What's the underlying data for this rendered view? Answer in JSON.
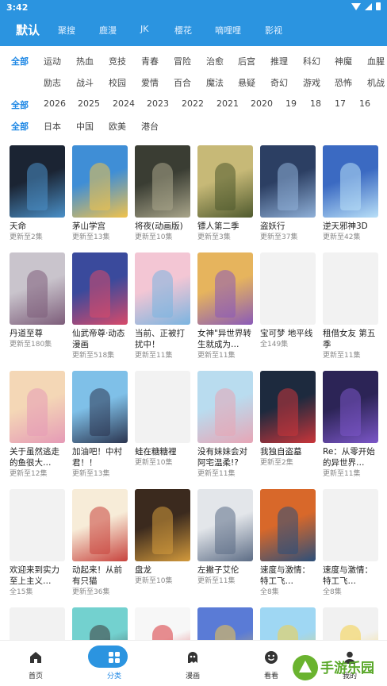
{
  "status_bar": {
    "time": "3:42"
  },
  "top_tabs": [
    "默认",
    "聚搜",
    "鹿漫",
    "JK",
    "樱花",
    "嘀哩哩",
    "影视"
  ],
  "filters": {
    "genre_row1": [
      "全部",
      "运动",
      "热血",
      "竞技",
      "青春",
      "冒险",
      "治愈",
      "后宫",
      "推理",
      "科幻",
      "神魔",
      "血腥"
    ],
    "genre_row2": [
      "励志",
      "战斗",
      "校园",
      "爱情",
      "百合",
      "魔法",
      "悬疑",
      "奇幻",
      "游戏",
      "恐怖",
      "机战"
    ],
    "years": [
      "全部",
      "2026",
      "2025",
      "2024",
      "2023",
      "2022",
      "2021",
      "2020",
      "19",
      "18",
      "17",
      "16"
    ],
    "regions": [
      "全部",
      "日本",
      "中国",
      "欧美",
      "港台"
    ]
  },
  "cards": [
    {
      "title": "天命",
      "sub": "更新至2集",
      "color": "#1b2433",
      "accent": "#4a90c8"
    },
    {
      "title": "茅山学宫",
      "sub": "更新至13集",
      "color": "#3f8ed6",
      "accent": "#f1c24b"
    },
    {
      "title": "将夜(动画版)",
      "sub": "更新至10集",
      "color": "#3a3d33",
      "accent": "#a9a58a"
    },
    {
      "title": "镖人第二季",
      "sub": "更新至3集",
      "color": "#c7b977",
      "accent": "#4f5a2e"
    },
    {
      "title": "盗妖行",
      "sub": "更新至37集",
      "color": "#2c3f63",
      "accent": "#8fb0d8"
    },
    {
      "title": "逆天邪神3D",
      "sub": "更新至42集",
      "color": "#3b6ac2",
      "accent": "#b9e0f8"
    },
    {
      "title": "丹道至尊",
      "sub": "更新至180集",
      "color": "#c9c4cc",
      "accent": "#7d5d7a"
    },
    {
      "title": "仙武帝尊·动态漫画",
      "sub": "更新至518集",
      "color": "#3a4a9c",
      "accent": "#d84a6a"
    },
    {
      "title": "当前、正被打扰中！",
      "sub": "更新至11集",
      "color": "#f3c6d4",
      "accent": "#7ab4e0"
    },
    {
      "title": "女神\"异世界转生就成为…",
      "sub": "更新至11集",
      "color": "#e6b45d",
      "accent": "#8a5ab8"
    },
    {
      "title": "宝可梦 地平线",
      "sub": "全149集",
      "color": "#f2f2f2",
      "accent": "#f2f2f2"
    },
    {
      "title": "租借女友 第五季",
      "sub": "更新至11集",
      "color": "#f2f2f2",
      "accent": "#f2f2f2"
    },
    {
      "title": "关于虽然逃走的鱼很大…",
      "sub": "更新至12集",
      "color": "#f4d7b6",
      "accent": "#e59ab6"
    },
    {
      "title": "加油吧！中村君！！",
      "sub": "更新至13集",
      "color": "#7fc0e8",
      "accent": "#2b3550"
    },
    {
      "title": "蛙在糖糖裡",
      "sub": "更新至10集",
      "color": "#f2f2f2",
      "accent": "#f2f2f2"
    },
    {
      "title": "没有妹妹会对阿宅温柔!?",
      "sub": "更新至11集",
      "color": "#b9dcef",
      "accent": "#e7a5b5"
    },
    {
      "title": "我独自盗墓",
      "sub": "更新至2集",
      "color": "#1d2a3e",
      "accent": "#c9353a"
    },
    {
      "title": "Re：从零开始的异世界…",
      "sub": "更新至11集",
      "color": "#2c2456",
      "accent": "#7b56c8"
    },
    {
      "title": "欢迎来到实力至上主义…",
      "sub": "全15集",
      "color": "#f2f2f2",
      "accent": "#f2f2f2"
    },
    {
      "title": "动起来！从前有只猫",
      "sub": "更新至36集",
      "color": "#f7ecd8",
      "accent": "#c8433d"
    },
    {
      "title": "盘龙",
      "sub": "更新至10集",
      "color": "#3b2a1e",
      "accent": "#d39a3c"
    },
    {
      "title": "左撇子艾伦",
      "sub": "更新至11集",
      "color": "#e3e6ea",
      "accent": "#5d6d86"
    },
    {
      "title": "速度与激情：特工飞…",
      "sub": "全8集",
      "color": "#d8682a",
      "accent": "#2c4f7a"
    },
    {
      "title": "速度与激情：特工飞…",
      "sub": "全8集",
      "color": "#f2f2f2",
      "accent": "#f2f2f2"
    },
    {
      "title": "",
      "sub": "",
      "color": "#f2f2f2",
      "accent": "#f2f2f2"
    },
    {
      "title": "",
      "sub": "",
      "color": "#73d1cf",
      "accent": "#3a3a3a"
    },
    {
      "title": "",
      "sub": "",
      "color": "#f7f7f7",
      "accent": "#d8343a"
    },
    {
      "title": "",
      "sub": "",
      "color": "#5a7bd6",
      "accent": "#f2c64b"
    },
    {
      "title": "",
      "sub": "",
      "color": "#9fd7f3",
      "accent": "#f4cf45"
    },
    {
      "title": "",
      "sub": "",
      "color": "#f1f1f1",
      "accent": "#f4cf45"
    }
  ],
  "bottom_nav": [
    "首页",
    "分类",
    "漫画",
    "看看",
    "我的"
  ],
  "colors": {
    "primary": "#2b94e0",
    "active_text": "#1f88e5"
  },
  "watermark": "手游乐园"
}
